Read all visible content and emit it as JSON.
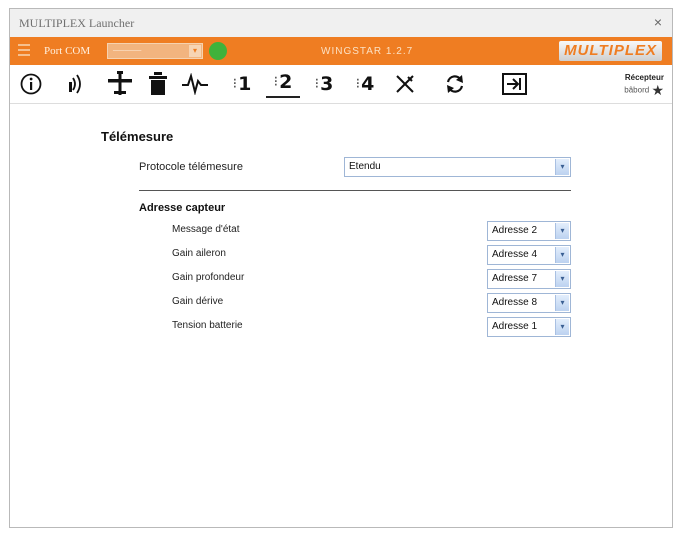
{
  "window": {
    "title": "MULTIPLEX Launcher",
    "close": "×"
  },
  "topbar": {
    "port_label": "Port COM",
    "port_value": "─────",
    "port_arrow": "▾",
    "version": "WINGSTAR 1.2.7",
    "brand": "MULTIPLEX",
    "accent": "#ef7d22",
    "status_color": "#3fb23b"
  },
  "toolbar": {
    "tabs": [
      {
        "id": "info",
        "icon": "info-circle-icon"
      },
      {
        "id": "telemetry",
        "icon": "antenna-icon"
      },
      {
        "id": "plane",
        "icon": "airplane-icon"
      },
      {
        "id": "receiver",
        "icon": "receiver-icon"
      },
      {
        "id": "mixer",
        "icon": "mixer-icon"
      },
      {
        "id": "flight-1",
        "label": "1",
        "prefix": "⁝"
      },
      {
        "id": "flight-2",
        "label": "2",
        "prefix": "⁝"
      },
      {
        "id": "flight-3",
        "label": "3",
        "prefix": "⁝"
      },
      {
        "id": "flight-4",
        "label": "4",
        "prefix": "⁝"
      },
      {
        "id": "tools",
        "icon": "tools-icon"
      },
      {
        "id": "sync",
        "icon": "sync-icon"
      },
      {
        "id": "exit",
        "icon": "exit-arrow-icon"
      }
    ],
    "receiver_title": "Récepteur",
    "receiver_status": "bâbord"
  },
  "page": {
    "title": "Télémesure",
    "protocol_label": "Protocole télémesure",
    "protocol_value": "Etendu",
    "sensor_section": "Adresse capteur",
    "sensors": [
      {
        "label": "Message d'état",
        "value": "Adresse 2"
      },
      {
        "label": "Gain aileron",
        "value": "Adresse 4"
      },
      {
        "label": "Gain profondeur",
        "value": "Adresse 7"
      },
      {
        "label": "Gain dérive",
        "value": "Adresse 8"
      },
      {
        "label": "Tension batterie",
        "value": "Adresse 1"
      }
    ],
    "select_arrow": "▾"
  }
}
